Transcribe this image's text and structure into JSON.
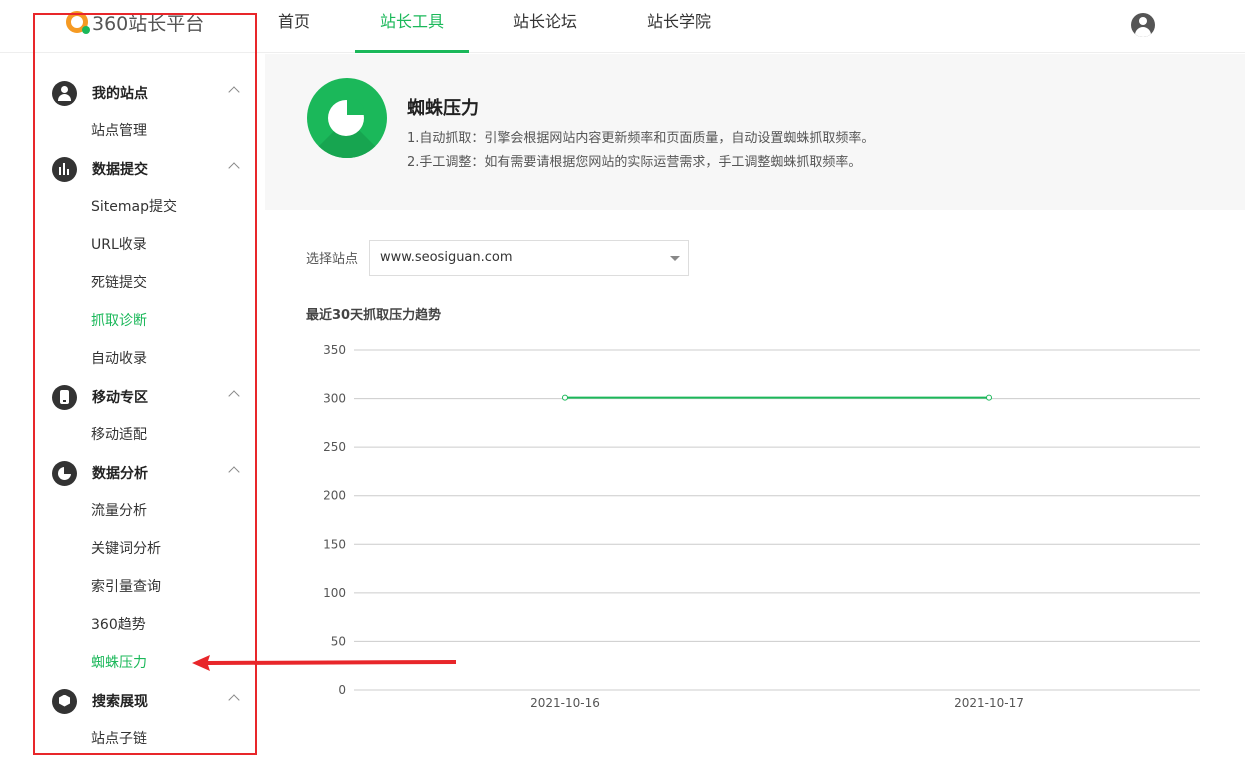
{
  "header": {
    "logo_text": "360站长平台",
    "nav": [
      {
        "label": "首页",
        "active": false
      },
      {
        "label": "站长工具",
        "active": true
      },
      {
        "label": "站长论坛",
        "active": false
      },
      {
        "label": "站长学院",
        "active": false
      }
    ],
    "accent_color": "#1bb85a"
  },
  "sidebar": {
    "groups": [
      {
        "label": "我的站点",
        "icon": "user-icon",
        "items": [
          {
            "label": "站点管理"
          }
        ]
      },
      {
        "label": "数据提交",
        "icon": "bar-chart-icon",
        "items": [
          {
            "label": "Sitemap提交"
          },
          {
            "label": "URL收录"
          },
          {
            "label": "死链提交"
          },
          {
            "label": "抓取诊断"
          },
          {
            "label": "自动收录"
          }
        ]
      },
      {
        "label": "移动专区",
        "icon": "phone-icon",
        "items": [
          {
            "label": "移动适配"
          }
        ]
      },
      {
        "label": "数据分析",
        "icon": "pie-chart-icon",
        "items": [
          {
            "label": "流量分析"
          },
          {
            "label": "关键词分析"
          },
          {
            "label": "索引量查询"
          },
          {
            "label": "360趋势"
          },
          {
            "label": "蜘蛛压力"
          }
        ]
      },
      {
        "label": "搜索展现",
        "icon": "cube-icon",
        "items": [
          {
            "label": "站点子链"
          }
        ]
      }
    ]
  },
  "banner": {
    "title": "蜘蛛压力",
    "desc1": "1.自动抓取：引擎会根据网站内容更新频率和页面质量，自动设置蜘蛛抓取频率。",
    "desc2": "2.手工调整：如有需要请根据您网站的实际运营需求，手工调整蜘蛛抓取频率。",
    "icon": "pie-chart-icon"
  },
  "site_select": {
    "label": "选择站点",
    "value": "www.seosiguan.com"
  },
  "chart_title": "最近30天抓取压力趋势",
  "chart_data": {
    "type": "line",
    "x": [
      "2021-10-16",
      "2021-10-17"
    ],
    "series": [
      {
        "values": [
          301,
          301
        ]
      }
    ],
    "ylim": [
      0,
      350
    ],
    "yticks": [
      0,
      50,
      100,
      150,
      200,
      250,
      300,
      350
    ],
    "grid": true,
    "line_color": "#1bb85a"
  }
}
